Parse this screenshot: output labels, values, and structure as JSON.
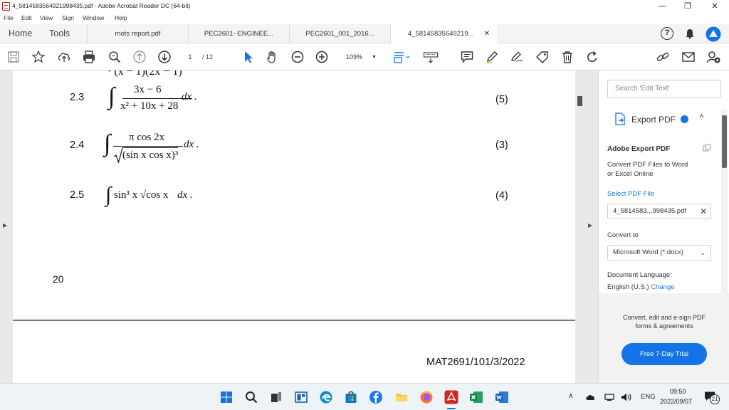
{
  "window": {
    "title": "4_5814583564921998435.pdf - Adobe Acrobat Reader DC (64-bit)",
    "minimize": "—",
    "maximize": "❐",
    "close": "✕"
  },
  "menu": [
    "File",
    "Edit",
    "View",
    "Sign",
    "Window",
    "Help"
  ],
  "nav": {
    "home": "Home",
    "tools": "Tools"
  },
  "tabs": [
    {
      "label": "mots report.pdf"
    },
    {
      "label": "PEC2601- ENGINEE..."
    },
    {
      "label": "PEC2601_001_2016..."
    },
    {
      "label": "4_58145835649219...",
      "close": "✕"
    }
  ],
  "toolbar": {
    "page_current": "1",
    "page_total": "/ 12",
    "zoom": "109%"
  },
  "document": {
    "prev_fragment": "(x − 1)(2x − 1)",
    "questions": [
      {
        "num": "2.3",
        "marks": "(5)",
        "numerator": "3x − 6",
        "denominator": "x² + 10x + 28",
        "dx": "dx ."
      },
      {
        "num": "2.4",
        "marks": "(3)",
        "numerator": "π cos 2x",
        "denominator": "(sin x cos x)³",
        "dx": "dx ."
      },
      {
        "num": "2.5",
        "marks": "(4)",
        "integrand": "sin³ x √cos x",
        "dx": "dx ."
      }
    ],
    "page_number": "20",
    "footer_code": "MAT2691/101/3/2022"
  },
  "right_pane": {
    "search_placeholder": "Search 'Edit Text'",
    "export_title": "Export PDF",
    "adobe_export_title": "Adobe Export PDF",
    "adobe_export_desc_1": "Convert PDF Files to Word",
    "adobe_export_desc_2": "or Excel Online",
    "select_file_label": "Select PDF File",
    "selected_file": "4_5814583...998435.pdf",
    "convert_to_label": "Convert to",
    "convert_to_value": "Microsoft Word (*.docx)",
    "doc_language_label": "Document Language:",
    "doc_language_value": "English (U.S.)",
    "change_link": "Change",
    "promo_1": "Convert, edit and e-sign PDF",
    "promo_2": "forms & agreements",
    "trial_button": "Free 7-Day Trial"
  },
  "taskbar": {
    "lang": "ENG",
    "time": "09:50",
    "date": "2022/09/07",
    "notifications": "21"
  },
  "colors": {
    "accent": "#1473e6",
    "acrobat_red": "#c3211b"
  }
}
